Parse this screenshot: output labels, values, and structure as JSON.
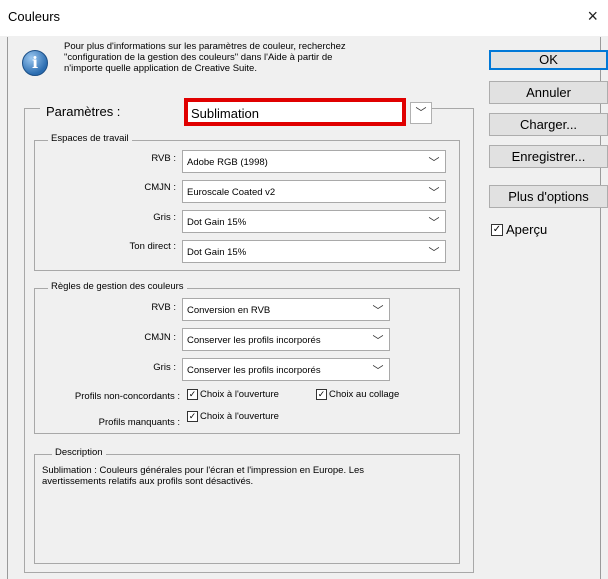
{
  "window": {
    "title": "Couleurs",
    "close_symbol": "×"
  },
  "info": {
    "text_line1": "Pour plus d'informations sur les paramètres de couleur, recherchez",
    "text_line2": "\"configuration de la gestion des couleurs\" dans l'Aide à partir de",
    "text_line3": "n'importe quelle application de Creative Suite.",
    "icon_glyph": "i",
    "icon": "info-icon"
  },
  "buttons": {
    "ok": "OK",
    "cancel": "Annuler",
    "load": "Charger...",
    "save": "Enregistrer...",
    "more": "Plus d'options"
  },
  "preview": {
    "label": "Aperçu",
    "checked": true
  },
  "settings": {
    "label": "Paramètres :",
    "value": "Sublimation",
    "highlight_color": "#e00000"
  },
  "workspaces": {
    "title": "Espaces de travail",
    "rows": [
      {
        "label": "RVB :",
        "value": "Adobe RGB (1998)"
      },
      {
        "label": "CMJN :",
        "value": "Euroscale Coated v2"
      },
      {
        "label": "Gris :",
        "value": "Dot Gain 15%"
      },
      {
        "label": "Ton direct :",
        "value": "Dot Gain 15%"
      }
    ]
  },
  "policies": {
    "title": "Règles de gestion des couleurs",
    "rows": [
      {
        "label": "RVB :",
        "value": "Conversion en RVB"
      },
      {
        "label": "CMJN :",
        "value": "Conserver les profils incorporés"
      },
      {
        "label": "Gris :",
        "value": "Conserver les profils incorporés"
      }
    ],
    "mismatch_label": "Profils non-concordants :",
    "mismatch_open": "Choix à l'ouverture",
    "mismatch_paste": "Choix au collage",
    "missing_label": "Profils manquants :",
    "missing_open": "Choix à l'ouverture"
  },
  "description": {
    "title": "Description",
    "text_line1": "Sublimation :  Couleurs générales pour l'écran et l'impression en Europe. Les",
    "text_line2": "avertissements relatifs aux profils sont désactivés."
  },
  "glyphs": {
    "chevron": "﹀",
    "check": "✓"
  }
}
